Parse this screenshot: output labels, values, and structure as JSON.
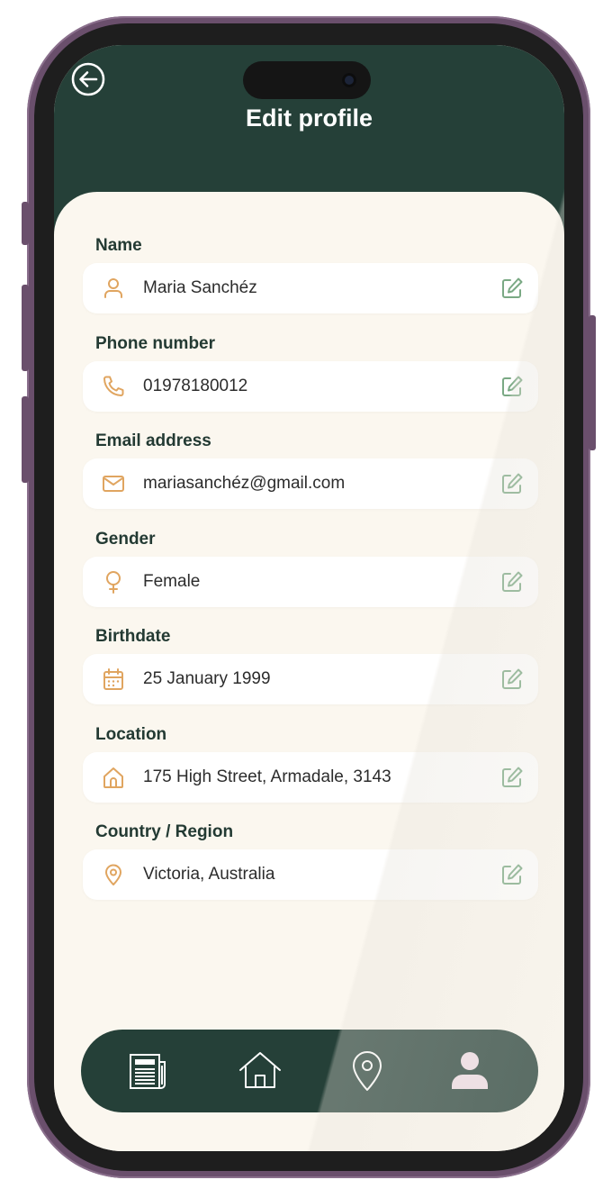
{
  "header": {
    "title": "Edit profile",
    "back_icon": "back-arrow-icon"
  },
  "fields": [
    {
      "label": "Name",
      "value": "Maria Sanchéz",
      "icon": "person-icon"
    },
    {
      "label": "Phone number",
      "value": "01978180012",
      "icon": "phone-icon"
    },
    {
      "label": "Email address",
      "value": "mariasanchéz@gmail.com",
      "icon": "mail-icon"
    },
    {
      "label": "Gender",
      "value": "Female",
      "icon": "female-icon"
    },
    {
      "label": "Birthdate",
      "value": "25 January 1999",
      "icon": "calendar-icon"
    },
    {
      "label": "Location",
      "value": "175 High Street, Armadale, 3143",
      "icon": "home-icon"
    },
    {
      "label": "Country / Region",
      "value": "Victoria, Australia",
      "icon": "location-pin-icon"
    }
  ],
  "nav": {
    "items": [
      {
        "icon": "newspaper-icon",
        "active": false
      },
      {
        "icon": "home-icon",
        "active": false
      },
      {
        "icon": "location-pin-icon",
        "active": false
      },
      {
        "icon": "profile-icon",
        "active": true
      }
    ]
  },
  "colors": {
    "header_bg": "#254038",
    "sheet_bg": "#fbf7ef",
    "field_icon": "#e0a560",
    "edit_icon": "#7aa984",
    "nav_bg": "#254038",
    "nav_active": "#f0dde6",
    "nav_inactive": "#ffffff",
    "frame": "#6a4f6c"
  }
}
